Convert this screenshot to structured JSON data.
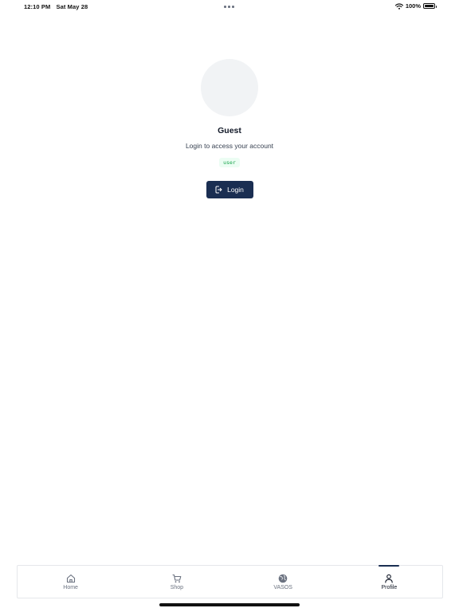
{
  "status_bar": {
    "time": "12:10 PM",
    "date": "Sat May 28",
    "battery": "100%",
    "icons": [
      "wifi-icon",
      "battery-icon"
    ]
  },
  "profile": {
    "name": "Guest",
    "subtitle": "Login to access your account",
    "role_badge": "user",
    "login_label": "Login",
    "login_icon": "login-arrow-icon",
    "colors": {
      "button": "#1a2e52",
      "badge_text": "#16a34a",
      "badge_bg": "#ecfdf3",
      "avatar": "#f1f3f5"
    }
  },
  "tab_bar": {
    "active": "Profile",
    "tabs": [
      {
        "label": "Home",
        "icon": "home-icon"
      },
      {
        "label": "Shop",
        "icon": "cart-icon"
      },
      {
        "label": "VASOS",
        "icon": "globe-icon"
      },
      {
        "label": "Profile",
        "icon": "user-icon"
      }
    ]
  }
}
